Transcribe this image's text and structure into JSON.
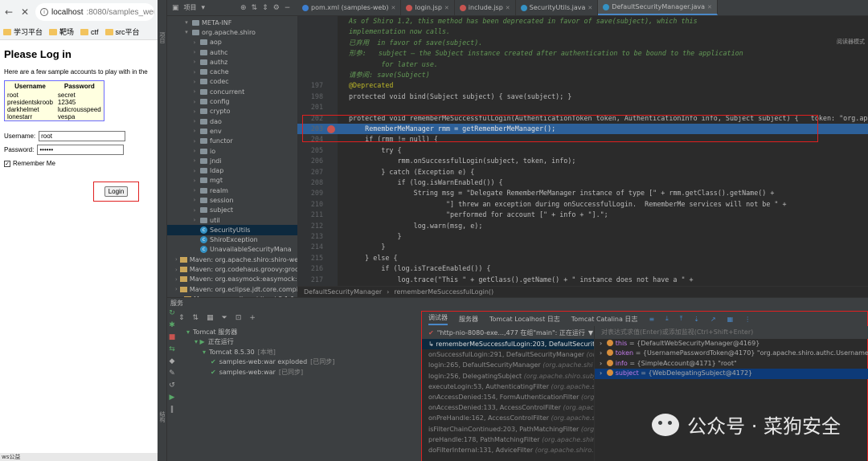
{
  "browser": {
    "url_host": "localhost",
    "url_path": ":8080/samples_web",
    "bookmarks": [
      "学习平台",
      "靶场",
      "ctf",
      "src平台"
    ],
    "heading": "Please Log in",
    "intro": "Here are a few sample accounts to play with in the",
    "table_headers": [
      "Username",
      "Password"
    ],
    "accounts": [
      [
        "root",
        "secret"
      ],
      [
        "presidentskroob",
        "12345"
      ],
      [
        "darkhelmet",
        "ludicrousspeed"
      ],
      [
        "lonestarr",
        "vespa"
      ]
    ],
    "username_label": "Username:",
    "username_value": "root",
    "password_label": "Password:",
    "password_value": "••••••",
    "remember_label": "Remember Me",
    "login_label": "Login",
    "status": "ws公益"
  },
  "ide": {
    "project_label": "项目",
    "tree": [
      {
        "indent": 2,
        "arrow": "▾",
        "kind": "pkg",
        "label": "META-INF"
      },
      {
        "indent": 2,
        "arrow": "▾",
        "kind": "pkg",
        "label": "org.apache.shiro"
      },
      {
        "indent": 3,
        "arrow": "›",
        "kind": "pkg",
        "label": "aop"
      },
      {
        "indent": 3,
        "arrow": "›",
        "kind": "pkg",
        "label": "authc"
      },
      {
        "indent": 3,
        "arrow": "›",
        "kind": "pkg",
        "label": "authz"
      },
      {
        "indent": 3,
        "arrow": "›",
        "kind": "pkg",
        "label": "cache"
      },
      {
        "indent": 3,
        "arrow": "›",
        "kind": "pkg",
        "label": "codec"
      },
      {
        "indent": 3,
        "arrow": "›",
        "kind": "pkg",
        "label": "concurrent"
      },
      {
        "indent": 3,
        "arrow": "›",
        "kind": "pkg",
        "label": "config"
      },
      {
        "indent": 3,
        "arrow": "›",
        "kind": "pkg",
        "label": "crypto"
      },
      {
        "indent": 3,
        "arrow": "›",
        "kind": "pkg",
        "label": "dao"
      },
      {
        "indent": 3,
        "arrow": "›",
        "kind": "pkg",
        "label": "env"
      },
      {
        "indent": 3,
        "arrow": "›",
        "kind": "pkg",
        "label": "functor"
      },
      {
        "indent": 3,
        "arrow": "›",
        "kind": "pkg",
        "label": "io"
      },
      {
        "indent": 3,
        "arrow": "›",
        "kind": "pkg",
        "label": "jndi"
      },
      {
        "indent": 3,
        "arrow": "›",
        "kind": "pkg",
        "label": "ldap"
      },
      {
        "indent": 3,
        "arrow": "›",
        "kind": "pkg",
        "label": "mgt"
      },
      {
        "indent": 3,
        "arrow": "›",
        "kind": "pkg",
        "label": "realm"
      },
      {
        "indent": 3,
        "arrow": "›",
        "kind": "pkg",
        "label": "session"
      },
      {
        "indent": 3,
        "arrow": "›",
        "kind": "pkg",
        "label": "subject"
      },
      {
        "indent": 3,
        "arrow": "›",
        "kind": "pkg",
        "label": "util"
      },
      {
        "indent": 3,
        "arrow": "",
        "kind": "cls",
        "label": "SecurityUtils",
        "selected": true
      },
      {
        "indent": 3,
        "arrow": "",
        "kind": "cls",
        "label": "ShiroException"
      },
      {
        "indent": 3,
        "arrow": "",
        "kind": "cls",
        "label": "UnavailableSecurityMana"
      },
      {
        "indent": 1,
        "arrow": "›",
        "kind": "lib",
        "label": "Maven: org.apache.shiro:shiro-web"
      },
      {
        "indent": 1,
        "arrow": "›",
        "kind": "lib",
        "label": "Maven: org.codehaus.groovy:groo"
      },
      {
        "indent": 1,
        "arrow": "›",
        "kind": "lib",
        "label": "Maven: org.easymock:easymock:3."
      },
      {
        "indent": 1,
        "arrow": "›",
        "kind": "lib",
        "label": "Maven: org.eclipse.jdt.core.compile"
      },
      {
        "indent": 1,
        "arrow": "›",
        "kind": "lib",
        "label": "Maven: org.eclipse.jdt:ecj:3.1.1"
      }
    ],
    "tabs": [
      {
        "label": "pom.xml (samples-web)",
        "color": "#3d7ecf",
        "active": false
      },
      {
        "label": "login.jsp",
        "color": "#c75450",
        "active": false
      },
      {
        "label": "include.jsp",
        "color": "#c75450",
        "active": false
      },
      {
        "label": "SecurityUtils.java",
        "color": "#3592c4",
        "active": false
      },
      {
        "label": "DefaultSecurityManager.java",
        "color": "#3592c4",
        "active": true
      }
    ],
    "reader_mode": "阅读器模式",
    "code_lines": [
      {
        "n": "",
        "cls": "doc",
        "text": "As of Shiro 1.2, this method has been deprecated in favor of save(subject), which this"
      },
      {
        "n": "",
        "cls": "doc",
        "text": "implementation now calls."
      },
      {
        "n": "",
        "cls": "doc",
        "text": "已弃用  in favor of save(subject)."
      },
      {
        "n": "",
        "cls": "doc",
        "text": "形参:   subject – the Subject instance created after authentication to be bound to the application"
      },
      {
        "n": "",
        "cls": "doc",
        "text": "        for later use."
      },
      {
        "n": "",
        "cls": "doc",
        "text": "请参阅: save(Subject)"
      },
      {
        "n": "197",
        "cls": "ann",
        "text": "@Deprecated"
      },
      {
        "n": "198",
        "cls": "",
        "text": "protected void bind(Subject subject) { save(subject); }"
      },
      {
        "n": "201",
        "cls": "",
        "text": ""
      },
      {
        "n": "202",
        "cls": "",
        "text": "protected void rememberMeSuccessfulLogin(AuthenticationToken token, AuthenticationInfo info, Subject subject) {   token: \"org.apache"
      },
      {
        "n": "203",
        "cls": "hl",
        "text": "    RememberMeManager rmm = getRememberMeManager();"
      },
      {
        "n": "204",
        "cls": "",
        "text": "    if (rmm != null) {"
      },
      {
        "n": "205",
        "cls": "",
        "text": "        try {"
      },
      {
        "n": "206",
        "cls": "",
        "text": "            rmm.onSuccessfulLogin(subject, token, info);"
      },
      {
        "n": "207",
        "cls": "",
        "text": "        } catch (Exception e) {"
      },
      {
        "n": "208",
        "cls": "",
        "text": "            if (log.isWarnEnabled()) {"
      },
      {
        "n": "209",
        "cls": "",
        "text": "                String msg = \"Delegate RememberMeManager instance of type [\" + rmm.getClass().getName() +"
      },
      {
        "n": "210",
        "cls": "",
        "text": "                        \"] threw an exception during onSuccessfulLogin.  RememberMe services will not be \" +"
      },
      {
        "n": "211",
        "cls": "",
        "text": "                        \"performed for account [\" + info + \"].\";"
      },
      {
        "n": "212",
        "cls": "",
        "text": "                log.warn(msg, e);"
      },
      {
        "n": "213",
        "cls": "",
        "text": "            }"
      },
      {
        "n": "214",
        "cls": "",
        "text": "        }"
      },
      {
        "n": "215",
        "cls": "",
        "text": "    } else {"
      },
      {
        "n": "216",
        "cls": "",
        "text": "        if (log.isTraceEnabled()) {"
      },
      {
        "n": "217",
        "cls": "",
        "text": "            log.trace(\"This \" + getClass().getName() + \" instance does not have a \" +"
      }
    ],
    "breadcrumb": [
      "DefaultSecurityManager",
      "rememberMeSuccessfulLogin()"
    ],
    "services_title": "服务",
    "svc_tree": [
      {
        "indent": 1,
        "icon": "▾",
        "label": "Tomcat 服务器",
        "extra": ""
      },
      {
        "indent": 2,
        "icon": "▾ ▶",
        "label": "正在运行",
        "extra": ""
      },
      {
        "indent": 3,
        "icon": "▾",
        "label": "Tomcat 8.5.30",
        "extra": "[本地]"
      },
      {
        "indent": 4,
        "icon": "✔",
        "label": "samples-web:war exploded",
        "extra": "[已同步]"
      },
      {
        "indent": 4,
        "icon": "✔",
        "label": "samples-web:war",
        "extra": "[已同步]"
      }
    ],
    "debug_tabs": [
      "调试器",
      "服务器",
      "Tomcat Localhost 日志",
      "Tomcat Catalina 日志"
    ],
    "thread": "\"http-nio-8080-exe...,477 在组\"main\": 正在运行",
    "var_placeholder": "对表达式求值(Enter)或添加监视(Ctrl+Shift+Enter)",
    "frames": [
      {
        "m": "rememberMeSuccessfulLogin:203, DefaultSecurityManage",
        "p": "",
        "sel": true
      },
      {
        "m": "onSuccessfulLogin:291, DefaultSecurityManager",
        "p": "(org.ap",
        "sel": false
      },
      {
        "m": "login:265, DefaultSecurityManager",
        "p": "(org.apache.shi",
        "sel": false
      },
      {
        "m": "login:256, DelegatingSubject",
        "p": "(org.apache.shiro.subject.",
        "sel": false
      },
      {
        "m": "executeLogin:53, AuthenticatingFilter",
        "p": "(org.apache.s",
        "sel": false
      },
      {
        "m": "onAccessDenied:154, FormAuthenticationFilter",
        "p": "(org.apach",
        "sel": false
      },
      {
        "m": "onAccessDenied:133, AccessControlFilter",
        "p": "(org.apache.s",
        "sel": false
      },
      {
        "m": "onPreHandle:162, AccessControlFilter",
        "p": "(org.apache.shiro",
        "sel": false
      },
      {
        "m": "isFilterChainContinued:203, PathMatchingFilter",
        "p": "(org.apa",
        "sel": false
      },
      {
        "m": "preHandle:178, PathMatchingFilter",
        "p": "(org.apache.shiro.web",
        "sel": false
      },
      {
        "m": "doFilterInternal:131, AdviceFilter",
        "p": "(org.apache.shiro.web",
        "sel": false
      }
    ],
    "vars": [
      {
        "name": "this",
        "value": "= {DefaultWebSecurityManager@4169}",
        "sel": false
      },
      {
        "name": "token",
        "value": "= {UsernamePasswordToken@4170} \"org.apache.shiro.authc.UsernamePasswordTok",
        "sel": false
      },
      {
        "name": "info",
        "value": "= {SimpleAccount@4171} \"root\"",
        "sel": false
      },
      {
        "name": "subject",
        "value": "= {WebDelegatingSubject@4172}",
        "sel": true
      }
    ],
    "watermark": "公众号 · 菜狗安全",
    "status_line": "行 109, 列 4"
  }
}
